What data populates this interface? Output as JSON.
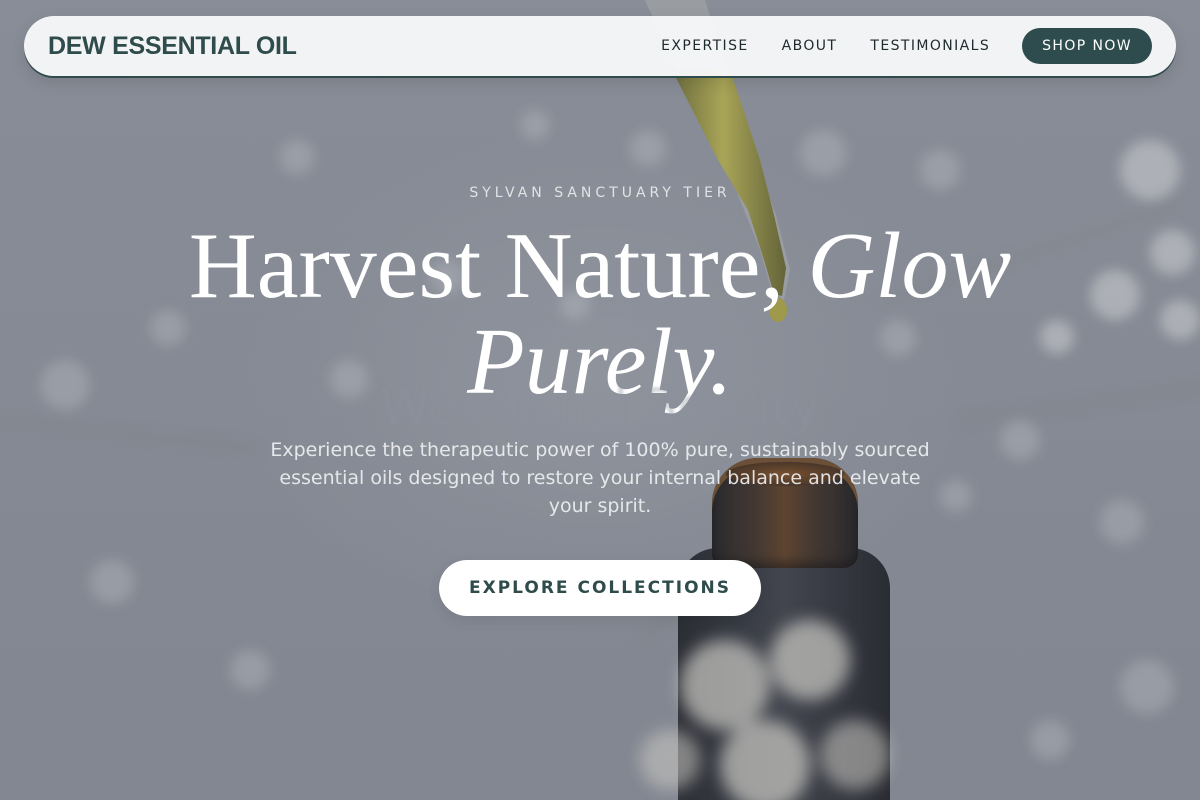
{
  "brand": {
    "name": "DEW ESSENTIAL OIL"
  },
  "nav": {
    "items": [
      {
        "label": "EXPERTISE"
      },
      {
        "label": "ABOUT"
      },
      {
        "label": "TESTIMONIALS"
      }
    ],
    "shop_label": "SHOP NOW"
  },
  "hero": {
    "eyebrow": "SYLVAN SANCTUARY TIER",
    "headline_plain": "Harvest Nature, ",
    "headline_italic_1": "Glow",
    "headline_italic_2": "Purely.",
    "ghost_text": "Woodland Beauty",
    "subtext": "Experience the therapeutic power of 100% pure, sustainably sourced essential oils designed to restore your internal balance and elevate your spirit.",
    "cta_label": "EXPLORE COLLECTIONS"
  },
  "colors": {
    "brand": "#2f4b4c",
    "shop_button": "#2e4c4d",
    "nav_background": "#f6f7f8",
    "cta_background": "#ffffff"
  }
}
